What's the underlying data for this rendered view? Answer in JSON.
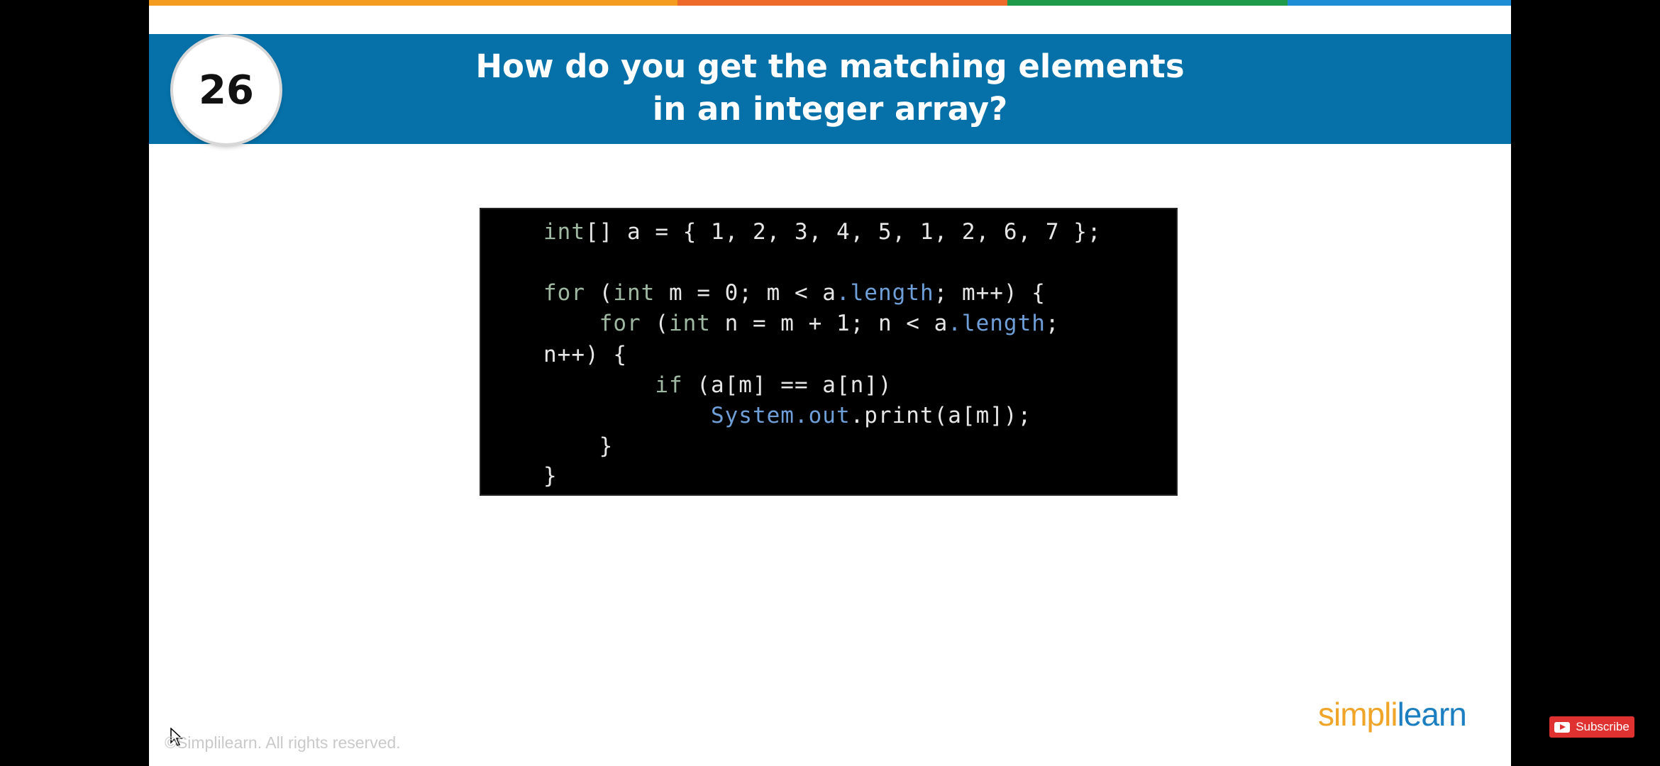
{
  "slide": {
    "number": "26",
    "title_line1": "How do you get the matching elements",
    "title_line2": "in an integer array?",
    "colors": {
      "band": "#0571a8",
      "strip": [
        "#f39c1f",
        "#ee6a2a",
        "#1f9a4a",
        "#1f8dd6"
      ]
    }
  },
  "code": {
    "lines": [
      "int[] a = { 1, 2, 3, 4, 5, 1, 2, 6, 7 };",
      "",
      "for (int m = 0; m < a.length; m++) {",
      "    for (int n = m + 1; n < a.length;",
      "n++) {",
      "        if (a[m] == a[n])",
      "            System.out.print(a[m]);",
      "    }",
      "}"
    ]
  },
  "footer": {
    "copyright": "©Simplilearn. All rights reserved.",
    "logo_part1": "simpl",
    "logo_sep": "i",
    "logo_part2": "learn"
  },
  "overlay": {
    "subscribe_label": "Subscribe",
    "icons": [
      "cursor-icon",
      "youtube-icon"
    ]
  }
}
